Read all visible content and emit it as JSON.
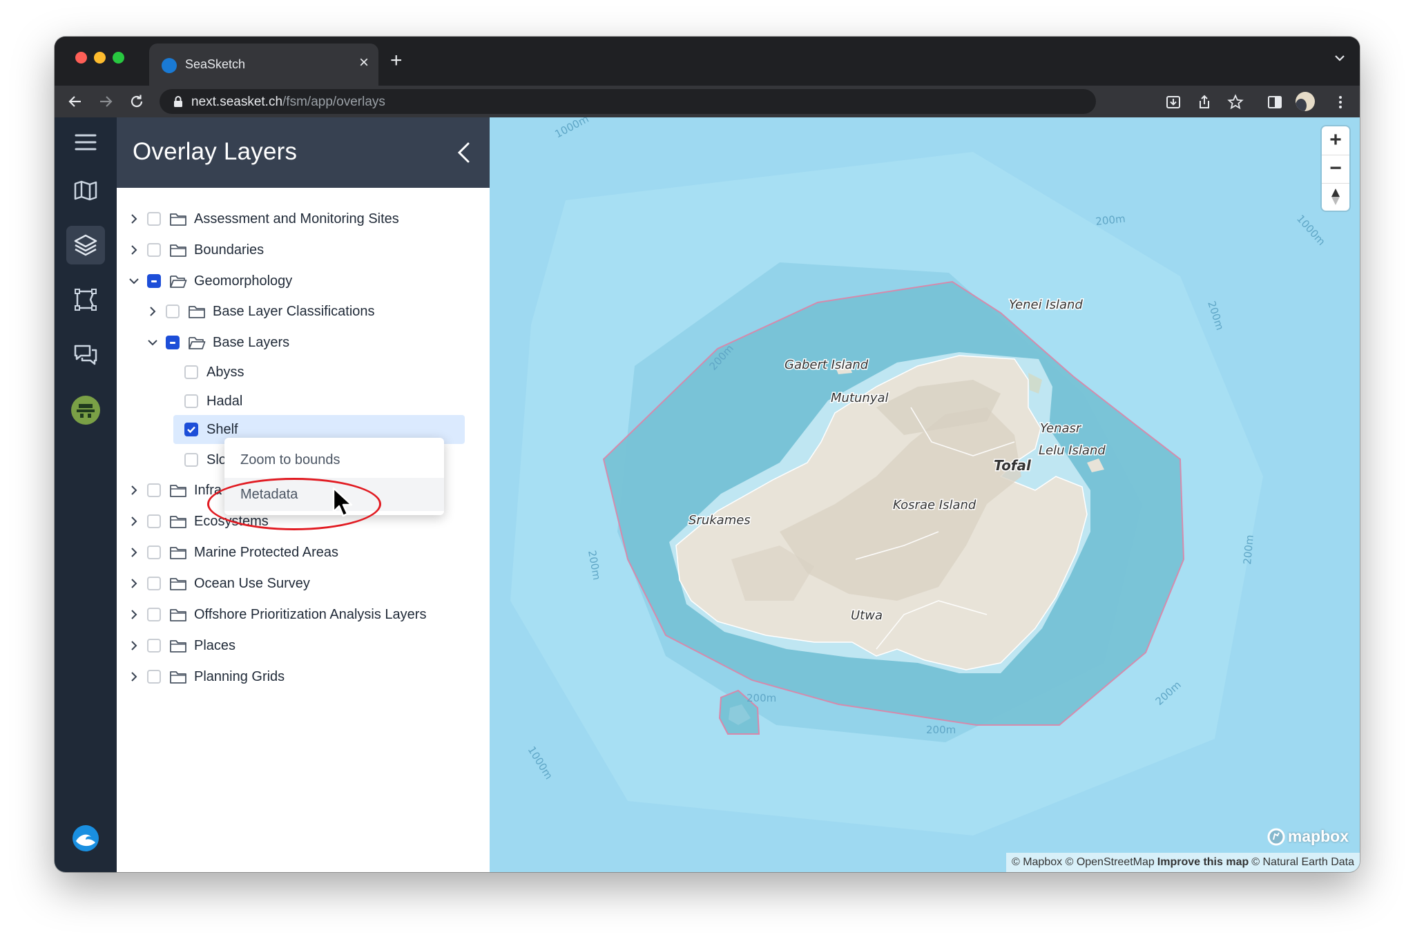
{
  "browser": {
    "tab_title": "SeaSketch",
    "url_host": "next.seasket.ch",
    "url_path": "/fsm/app/overlays"
  },
  "panel": {
    "title": "Overlay Layers"
  },
  "tree": {
    "assessment": "Assessment and Monitoring Sites",
    "boundaries": "Boundaries",
    "geomorphology": "Geomorphology",
    "base_layer_classifications": "Base Layer Classifications",
    "base_layers": "Base Layers",
    "abyss": "Abyss",
    "hadal": "Hadal",
    "shelf": "Shelf",
    "slope_partial": "Slo",
    "infra_partial": "Infra",
    "ecosystems": "Ecosystems",
    "mpa": "Marine Protected Areas",
    "ocean_use": "Ocean Use Survey",
    "offshore": "Offshore Prioritization Analysis Layers",
    "places": "Places",
    "planning_grids": "Planning Grids"
  },
  "context_menu": {
    "zoom": "Zoom to bounds",
    "metadata": "Metadata"
  },
  "map": {
    "labels": {
      "yenei": "Yenei Island",
      "gabert": "Gabert Island",
      "mutunyal": "Mutunyal",
      "yenasr": "Yenasr",
      "lelu": "Lelu Island",
      "tofal": "Tofal",
      "kosrae": "Kosrae Island",
      "srukames": "Srukames",
      "utwa": "Utwa"
    },
    "contours": {
      "c200": "200m",
      "c1000": "1000m"
    },
    "attribution": {
      "mapbox": "© Mapbox",
      "osm": "© OpenStreetMap",
      "improve": "Improve this map",
      "ne": "© Natural Earth Data"
    },
    "logo": "mapbox"
  },
  "colors": {
    "accent": "#1d4ed8",
    "rail": "#1f2937",
    "header": "#374151",
    "annotation": "#e11b22"
  }
}
